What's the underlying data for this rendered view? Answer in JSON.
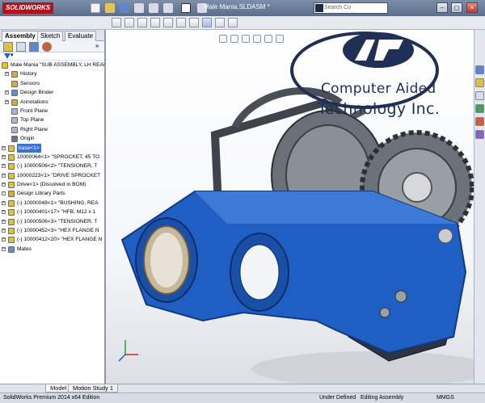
{
  "app": {
    "logo_text": "SOLIDWORKS",
    "document_title": "Male Mania.SLDASM *",
    "search_placeholder": "Search Co",
    "window_controls": [
      "–",
      "◻",
      "×"
    ]
  },
  "panel_tabs": [
    "Assembly",
    "Sketch",
    "Evaluate"
  ],
  "tree": {
    "root": "Male Mania \"SUB ASSEMBLY, LH REAR",
    "items": [
      {
        "label": "History",
        "indent": 1,
        "expander": "+",
        "icon": "folder-icon",
        "color": "#d9a93a"
      },
      {
        "label": "Sensors",
        "indent": 1,
        "expander": "",
        "icon": "sensor-icon",
        "color": "#d9a93a"
      },
      {
        "label": "Design Binder",
        "indent": 1,
        "expander": "+",
        "icon": "binder-icon",
        "color": "#5e8fd6"
      },
      {
        "label": "Annotations",
        "indent": 1,
        "expander": "+",
        "icon": "annotation-icon",
        "color": "#d9a93a"
      },
      {
        "label": "Front Plane",
        "indent": 1,
        "expander": "",
        "icon": "plane-icon",
        "color": "#a9b8cc"
      },
      {
        "label": "Top Plane",
        "indent": 1,
        "expander": "",
        "icon": "plane-icon",
        "color": "#a9b8cc"
      },
      {
        "label": "Right Plane",
        "indent": 1,
        "expander": "",
        "icon": "plane-icon",
        "color": "#a9b8cc"
      },
      {
        "label": "Origin",
        "indent": 1,
        "expander": "",
        "icon": "origin-icon",
        "color": "#6a7687"
      },
      {
        "label": "base<1>",
        "indent": 0,
        "expander": "+",
        "icon": "part-icon",
        "color": "#e0c23a",
        "selected": true
      },
      {
        "label": "10000064<1> \"SPROCKET, 45 TO",
        "indent": 0,
        "expander": "+",
        "icon": "part-icon",
        "color": "#e0c23a"
      },
      {
        "label": "(-) 10000506<2> \"TENSIONER, T",
        "indent": 0,
        "expander": "+",
        "icon": "part-icon",
        "color": "#e0c23a"
      },
      {
        "label": "10000223<1> \"DRIVE SPROCKET",
        "indent": 0,
        "expander": "+",
        "icon": "part-icon",
        "color": "#e0c23a"
      },
      {
        "label": "Drive<1> (Dissolved in BOM)",
        "indent": 0,
        "expander": "+",
        "icon": "assembly-icon",
        "color": "#e0c23a"
      },
      {
        "label": "Design Library Parts",
        "indent": 0,
        "expander": "-",
        "icon": "folder-icon",
        "color": "#d9a93a"
      },
      {
        "label": "(-) 10000048<1> \"BUSHING, REA",
        "indent": 0,
        "expander": "+",
        "icon": "part-icon",
        "color": "#e0c23a"
      },
      {
        "label": "(-) 10000401<17> \"HFB, M12 x 1",
        "indent": 0,
        "expander": "+",
        "icon": "part-icon",
        "color": "#e0c23a"
      },
      {
        "label": "(-) 10000506<3> \"TENSIONER, T",
        "indent": 0,
        "expander": "+",
        "icon": "part-icon",
        "color": "#e0c23a"
      },
      {
        "label": "(-) 10000452<3> \"HEX FLANGE N",
        "indent": 0,
        "expander": "+",
        "icon": "part-icon",
        "color": "#e0c23a"
      },
      {
        "label": "(-) 10000412<20> \"HEX FLANGE N",
        "indent": 0,
        "expander": "+",
        "icon": "part-icon",
        "color": "#e0c23a"
      },
      {
        "label": "Mates",
        "indent": 0,
        "expander": "+",
        "icon": "mates-icon",
        "color": "#5e8fd6"
      }
    ]
  },
  "branding": {
    "line1": "Computer Aided",
    "line2": "Technology Inc.",
    "colors": {
      "navy": "#1f2f55",
      "ring": "#1f2f55"
    }
  },
  "bottom_tabs": [
    "Model",
    "Motion Study 1"
  ],
  "status": {
    "product": "SolidWorks Premium 2014 x64 Edition",
    "state": "Under Defined",
    "mode": "Editing Assembly",
    "units": "MMGS"
  },
  "colors": {
    "part_blue": "#1f5fc4",
    "titlebar": "#5a6e8c",
    "selection": "#3a74cf"
  }
}
